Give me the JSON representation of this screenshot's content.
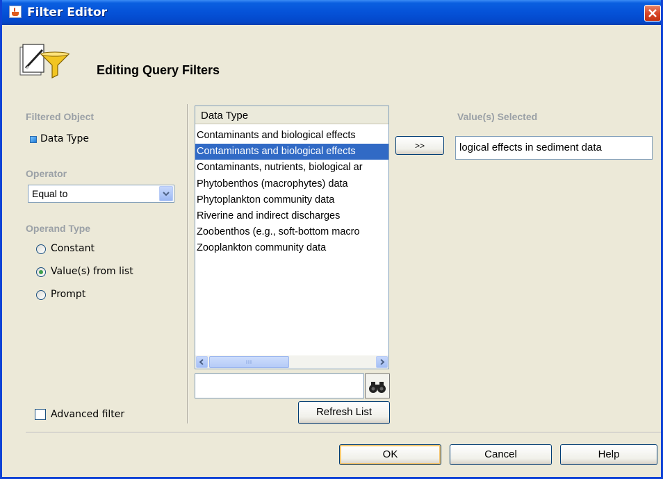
{
  "window": {
    "title": "Filter Editor"
  },
  "header": {
    "title": "Editing Query Filters",
    "icon": "filter-editor-icon"
  },
  "filtered_object": {
    "label": "Filtered Object",
    "value": "Data Type"
  },
  "operator": {
    "label": "Operator",
    "value": "Equal to"
  },
  "operand_type": {
    "label": "Operand Type",
    "options": [
      {
        "label": "Constant",
        "checked": false
      },
      {
        "label": "Value(s) from list",
        "checked": true
      },
      {
        "label": "Prompt",
        "checked": false
      }
    ]
  },
  "advanced_filter": {
    "label": "Advanced filter",
    "checked": false
  },
  "list": {
    "header": "Data Type",
    "items": [
      "Contaminants and biological effects",
      "Contaminants and biological effects",
      "Contaminants, nutrients, biological ar",
      "Phytobenthos (macrophytes) data",
      "Phytoplankton community data",
      "Riverine and indirect discharges",
      "Zoobenthos (e.g., soft-bottom macro",
      "Zooplankton community data"
    ],
    "selected_index": 1
  },
  "search": {
    "value": "",
    "button_icon": "binoculars-icon"
  },
  "refresh_button": "Refresh List",
  "add_button": ">>",
  "values_selected": {
    "label": "Value(s) Selected",
    "value": "logical effects in sediment data"
  },
  "buttons": {
    "ok": "OK",
    "cancel": "Cancel",
    "help": "Help"
  },
  "colors": {
    "title_bar": "#0552d8",
    "selection": "#316ac5",
    "dialog_bg": "#ece9d8",
    "disabled_label": "#9aa0a6"
  }
}
